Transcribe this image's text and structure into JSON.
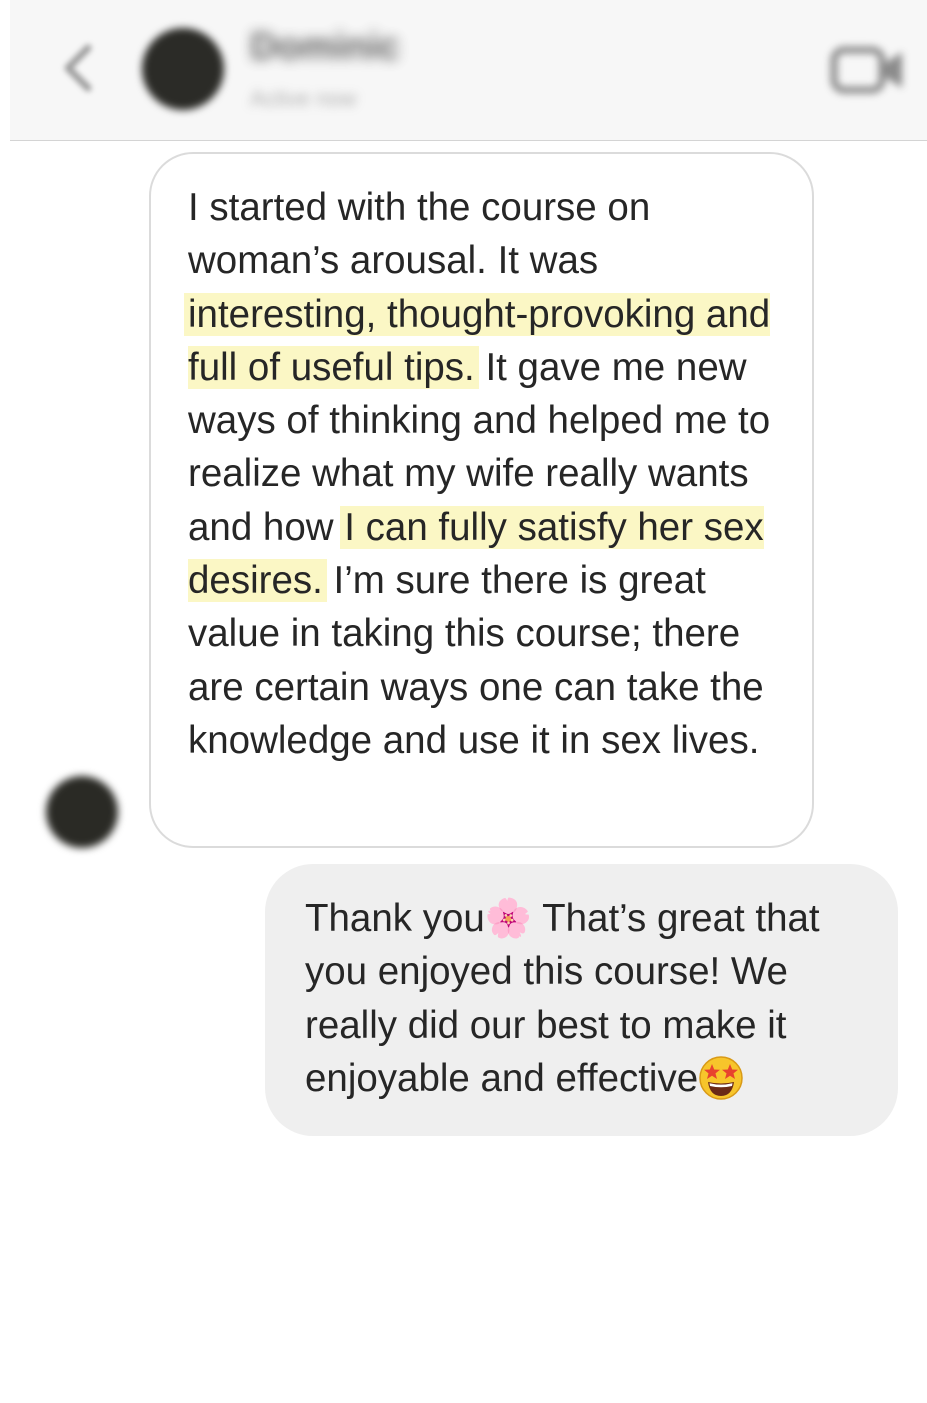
{
  "header": {
    "contact_name": "Dominic",
    "status": "Active now",
    "back_icon": "chevron-left-icon",
    "call_icon": "video-camera-icon"
  },
  "messages": {
    "received": {
      "segments": [
        "I started with the course on woman’s arousal. It was ",
        "interesting, thought-provoking and full of useful tips.",
        " It gave me new ways of thinking and helped me to realize what my wife really wants and how ",
        "I can fully satisfy her sex desires.",
        " I’m sure there is great value in taking this course; there are certain ways one can take the knowledge and use it in sex lives."
      ],
      "highlight_color": "#fbf7c5"
    },
    "sent": {
      "part1": "Thank you",
      "emoji1": "🌸",
      "part2": " That’s great that you enjoyed this course! We really did our best to make it enjoyable and effective",
      "emoji2_name": "star-struck-emoji"
    }
  },
  "colors": {
    "received_border": "#dbdbdb",
    "sent_background": "#efefef",
    "text": "#262626"
  }
}
